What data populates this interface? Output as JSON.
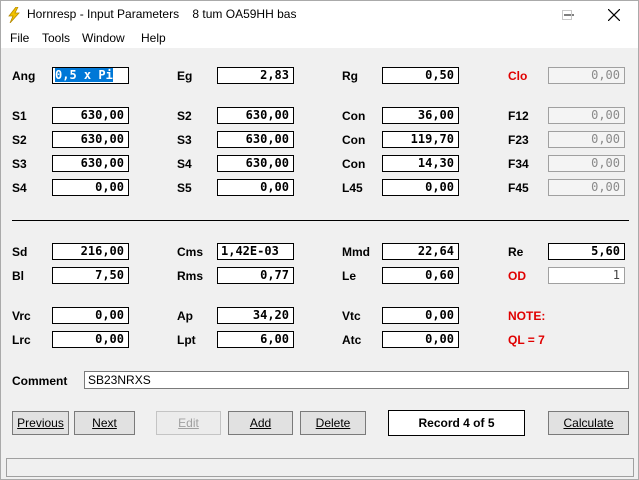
{
  "window": {
    "title": "Hornresp - Input Parameters    8 tum OA59HH bas"
  },
  "menu": [
    "File",
    "Tools",
    "Window",
    "Help"
  ],
  "params": {
    "Ang": "0,5 x Pi",
    "Eg": "2,83",
    "Rg": "0,50",
    "Clo": "0,00",
    "S1a": "630,00",
    "S2a": "630,00",
    "Con1": "36,00",
    "F12": "0,00",
    "S2b": "630,00",
    "S3a": "630,00",
    "Con2": "119,70",
    "F23": "0,00",
    "S3b": "630,00",
    "S4a": "630,00",
    "Con3": "14,30",
    "F34": "0,00",
    "S4b": "0,00",
    "S5": "0,00",
    "L45": "0,00",
    "F45": "0,00",
    "Sd": "216,00",
    "Cms": "1,42E-03",
    "Mmd": "22,64",
    "Re": "5,60",
    "Bl": "7,50",
    "Rms": "0,77",
    "Le": "0,60",
    "OD": "1",
    "Vrc": "0,00",
    "Ap": "34,20",
    "Vtc": "0,00",
    "Lrc": "0,00",
    "Lpt": "6,00",
    "Atc": "0,00"
  },
  "labels": {
    "Ang": "Ang",
    "Eg": "Eg",
    "Rg": "Rg",
    "Clo": "Clo",
    "S1": "S1",
    "S2": "S2",
    "Con": "Con",
    "F12": "F12",
    "S3": "S3",
    "F23": "F23",
    "S4": "S4",
    "F34": "F34",
    "S5": "S5",
    "L45": "L45",
    "F45": "F45",
    "Sd": "Sd",
    "Cms": "Cms",
    "Mmd": "Mmd",
    "Re": "Re",
    "Bl": "Bl",
    "Rms": "Rms",
    "Le": "Le",
    "OD": "OD",
    "Vrc": "Vrc",
    "Ap": "Ap",
    "Vtc": "Vtc",
    "Note": "NOTE:",
    "Lrc": "Lrc",
    "Lpt": "Lpt",
    "Atc": "Atc",
    "QL": "QL = 7",
    "Comment": "Comment"
  },
  "comment": "SB23NRXS",
  "buttons": {
    "previous": "Previous",
    "next": "Next",
    "edit": "Edit",
    "add": "Add",
    "delete": "Delete",
    "calculate": "Calculate"
  },
  "record": "Record 4 of 5",
  "colors": {
    "red_label": "#e00000",
    "selection": "#0078d7"
  }
}
